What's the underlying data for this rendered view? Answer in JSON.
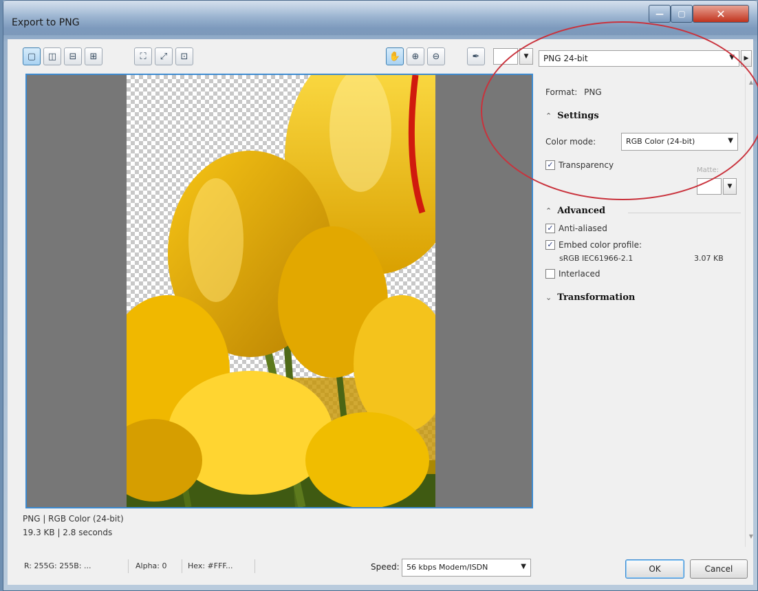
{
  "window": {
    "title": "Export to PNG"
  },
  "toolbar": {
    "layout_buttons": [
      {
        "name": "single-view-icon",
        "glyph": "▢",
        "active": true
      },
      {
        "name": "split-vertical-icon",
        "glyph": "◫",
        "active": false
      },
      {
        "name": "split-horizontal-icon",
        "glyph": "⊟",
        "active": false
      },
      {
        "name": "quad-view-icon",
        "glyph": "⊞",
        "active": false
      }
    ],
    "tool_buttons": [
      {
        "name": "fit-image-icon",
        "glyph": "⛶"
      },
      {
        "name": "zoom-actual-icon",
        "glyph": "⤢"
      },
      {
        "name": "zoom-page-icon",
        "glyph": "⊡"
      }
    ],
    "view_buttons": [
      {
        "name": "hand-pan-icon",
        "glyph": "✋",
        "active": true
      },
      {
        "name": "zoom-in-icon",
        "glyph": "⊕",
        "active": false
      },
      {
        "name": "zoom-out-icon",
        "glyph": "⊖",
        "active": false
      }
    ],
    "eyedropper_icon": "✒",
    "format_select": "PNG 24-bit",
    "dropdown_glyph": "▼",
    "next_glyph": "▶"
  },
  "panel": {
    "format_label": "Format:",
    "format_value": "PNG",
    "settings_header": "Settings",
    "color_mode_label": "Color mode:",
    "color_mode_value": "RGB Color (24-bit)",
    "transparency_label": "Transparency",
    "transparency_checked": true,
    "matte_label": "Matte:",
    "advanced_header": "Advanced",
    "anti_aliased_label": "Anti-aliased",
    "anti_aliased_checked": true,
    "embed_profile_label": "Embed color profile:",
    "embed_profile_checked": true,
    "profile_name": "sRGB IEC61966-2.1",
    "profile_size": "3.07 KB",
    "interlaced_label": "Interlaced",
    "interlaced_checked": false,
    "transformation_header": "Transformation",
    "collapse_glyph": "⌃",
    "expand_glyph": "⌄"
  },
  "status": {
    "line1": "PNG  |  RGB Color (24-bit)",
    "line2": "19.3 KB  |  2.8 seconds",
    "rgb": "R: 255G: 255B: ...",
    "alpha": "Alpha: 0",
    "hex": "Hex: #FFF..."
  },
  "speed": {
    "label": "Speed:",
    "value": "56 kbps Modem/ISDN"
  },
  "buttons": {
    "ok": "OK",
    "cancel": "Cancel"
  },
  "colors": {
    "accent": "#3c8ad0",
    "annotation": "#c9323c",
    "tulip": "#f2c21a"
  }
}
